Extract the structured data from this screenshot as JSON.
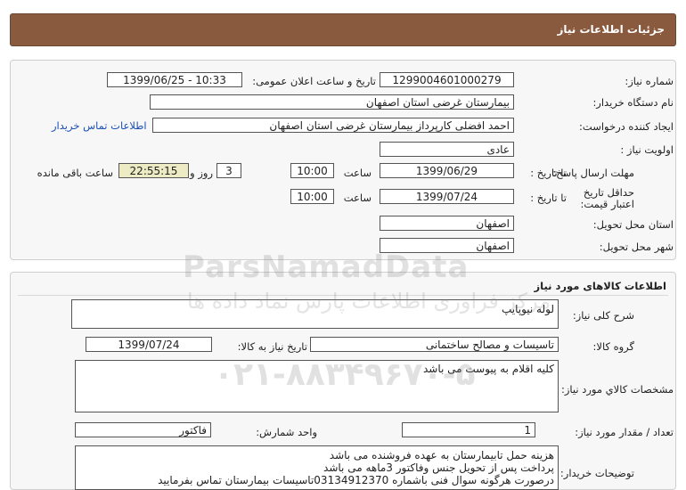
{
  "header": {
    "title": "جزئیات اطلاعات نیاز"
  },
  "info": {
    "need_number": {
      "label": "شماره نیاز:",
      "value": "1299004601000279"
    },
    "announce": {
      "label": "تاریخ و ساعت اعلان عمومی:",
      "value": "1399/06/25 - 10:33"
    },
    "buyer": {
      "label": "نام دستگاه خریدار:",
      "value": "بیمارستان غرضی استان اصفهان"
    },
    "creator": {
      "label": "ایجاد کننده درخواست:",
      "value": "احمد افضلی کارپرداز بیمارستان غرضی استان اصفهان"
    },
    "contact_link": "اطلاعات تماس خریدار",
    "priority": {
      "label": "اولویت نیاز :",
      "value": "عادی"
    },
    "deadline": {
      "label": "مهلت ارسال پاسخ:",
      "to_date_label": "تا تاریخ :",
      "date": "1399/06/29",
      "time_label": "ساعت",
      "time": "10:00",
      "days": "3",
      "days_label": "روز و",
      "remaining": "22:55:15",
      "remaining_label": "ساعت باقی مانده"
    },
    "validity": {
      "label": "حداقل تاریخ اعتبار قیمت:",
      "to_date_label": "تا تاریخ :",
      "date": "1399/07/24",
      "time_label": "ساعت",
      "time": "10:00"
    },
    "province": {
      "label": "استان محل تحویل:",
      "value": "اصفهان"
    },
    "city": {
      "label": "شهر محل تحویل:",
      "value": "اصفهان"
    }
  },
  "goods": {
    "title": "اطلاعات کالاهای مورد نیاز",
    "summary": {
      "label": "شرح کلی نیاز:",
      "value": "لوله نیوپایپ"
    },
    "group": {
      "label": "گروه کالا:",
      "value": "تاسیسات و مصالح ساختمانی"
    },
    "need_date": {
      "label": "تاریخ نیاز به کالا:",
      "value": "1399/07/24"
    },
    "specs": {
      "label": "مشخصات کالاي مورد نیاز:",
      "value": "کلیه اقلام به پیوست می باشد"
    },
    "quantity": {
      "label": "تعداد / مقدار مورد نیاز:",
      "value": "1"
    },
    "unit": {
      "label": "واحد شمارش:",
      "value": "فاکتور"
    },
    "notes": {
      "label": "توضیحات خریدار:",
      "lines": [
        "هزینه حمل تابیمارستان به عهده فروشنده می باشد",
        "پرداخت پس از تحویل جنس وفاکتور 3ماهه می باشد",
        "درصورت هرگونه سوال فنی باشماره 03134912370تاسیسات بیمارستان تماس بفرمایید"
      ]
    }
  },
  "watermark": {
    "brand": "ParsNamadData",
    "tagline": "مرکز فراوری اطلاعات پارس نماد داده ها",
    "phone": "۰۲۱-۸۸۳۴۹۶۷۰-۵"
  }
}
